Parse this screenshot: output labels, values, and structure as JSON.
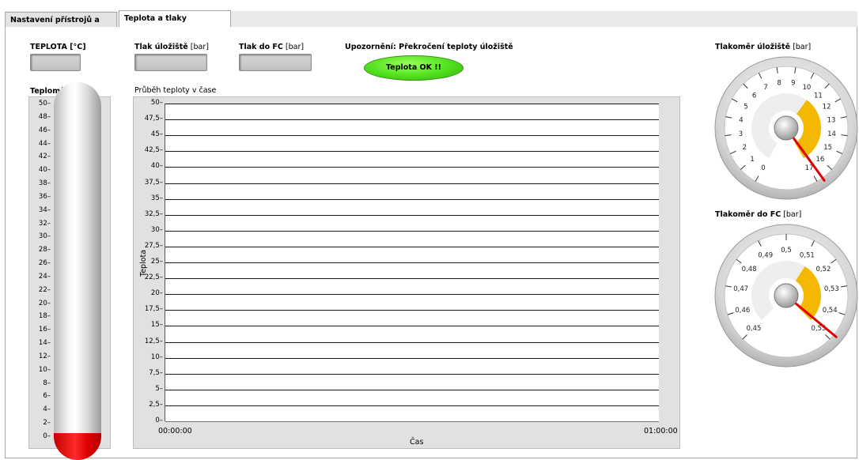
{
  "tabs": [
    {
      "label": "Nastavení přístrojů a měření",
      "active": false
    },
    {
      "label": "Teplota a tlaky",
      "active": true
    }
  ],
  "indicators": {
    "teplota_label": "TEPLOTA [°C]",
    "tlak_ulozistee_bold": "Tlak úložiště",
    "tlak_ulozistee_unit": " [bar]",
    "tlak_fc_bold": "Tlak do FC",
    "tlak_fc_unit": " [bar]"
  },
  "warning": {
    "label": "Upozornění: Překročení teploty úložiště",
    "led_text": "Teplota OK !!",
    "led_color": "#4fe01c"
  },
  "thermometer": {
    "label": "Teploměr",
    "scale": [
      "50",
      "48",
      "46",
      "44",
      "42",
      "40",
      "38",
      "36",
      "34",
      "32",
      "30",
      "28",
      "26",
      "24",
      "22",
      "20",
      "18",
      "16",
      "14",
      "12",
      "10",
      "8",
      "6",
      "4",
      "2",
      "0"
    ],
    "fill_fraction": 0
  },
  "chart_data": {
    "type": "line",
    "title": "Průběh teploty v čase",
    "xlabel": "Čas",
    "ylabel": "Teplota",
    "ylim": [
      0,
      50
    ],
    "yticks": [
      "50",
      "47,5",
      "45",
      "42,5",
      "40",
      "37,5",
      "35",
      "32,5",
      "30",
      "27,5",
      "25",
      "22,5",
      "20",
      "17,5",
      "15",
      "12,5",
      "10",
      "7,5",
      "5",
      "2,5",
      "0"
    ],
    "xticks": [
      "00:00:00",
      "01:00:00"
    ],
    "grid": true,
    "series": []
  },
  "gauge_top": {
    "label_bold": "Tlakoměr úložiště",
    "label_unit": " [bar]",
    "scale": [
      "0",
      "1",
      "2",
      "3",
      "4",
      "5",
      "6",
      "7",
      "8",
      "9",
      "10",
      "11",
      "12",
      "13",
      "14",
      "15",
      "16",
      "17"
    ],
    "needle_value": 17
  },
  "gauge_bottom": {
    "label_bold": "Tlakoměr do FC",
    "label_unit": " [bar]",
    "scale": [
      "0,45",
      "0,46",
      "0,47",
      "0,48",
      "0,49",
      "0,5",
      "0,51",
      "0,52",
      "0,53",
      "0,54",
      "0,55"
    ],
    "needle_value": 0.55
  },
  "colors": {
    "gauge_arc": "#f5b800",
    "needle": "#e00000",
    "bulb": "#e00000"
  }
}
